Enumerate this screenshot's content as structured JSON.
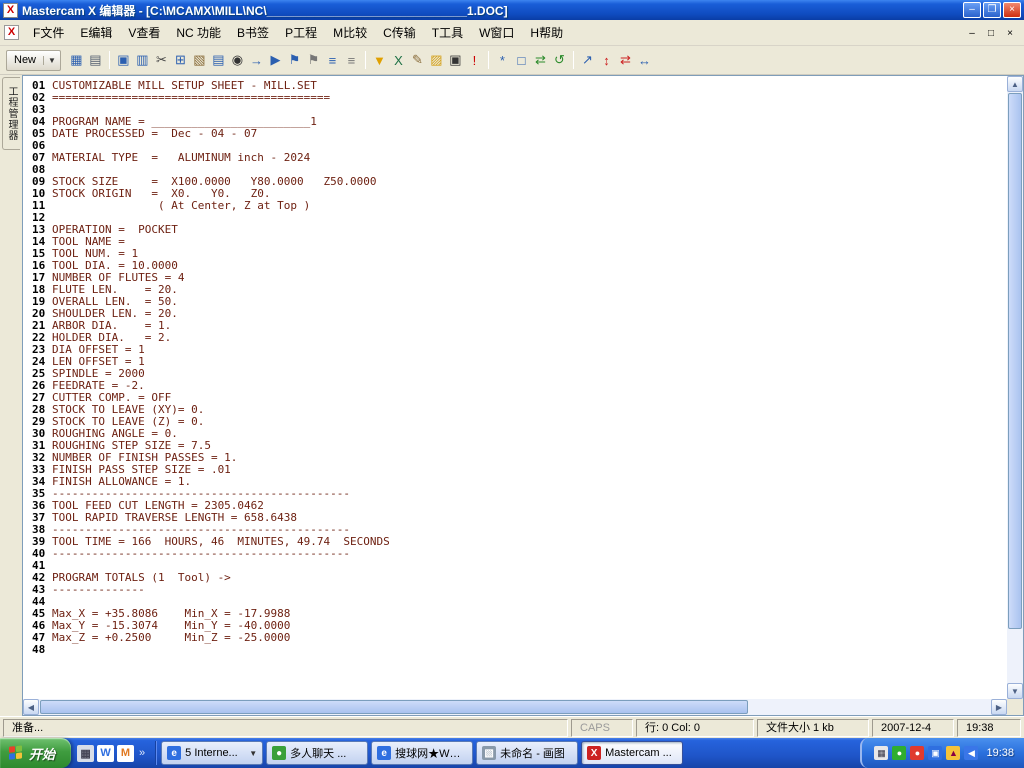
{
  "window": {
    "title": "Mastercam X 编辑器 - [C:\\MCAMX\\MILL\\NC\\______________________________1.DOC]",
    "minimize": "–",
    "maximize": "❐",
    "close": "×"
  },
  "menu": {
    "items": [
      "F文件",
      "E编辑",
      "V查看",
      "NC 功能",
      "B书签",
      "P工程",
      "M比较",
      "C传输",
      "T工具",
      "W窗口",
      "H帮助"
    ],
    "mdi": [
      "–",
      "□",
      "×"
    ]
  },
  "toolbar": {
    "new_label": "New",
    "icons": [
      {
        "name": "save-icon",
        "glyph": "▦",
        "color": "#2b5fb0"
      },
      {
        "name": "print-icon",
        "glyph": "▤",
        "color": "#556070"
      },
      {
        "sep": true
      },
      {
        "name": "open-icon",
        "glyph": "▣",
        "color": "#2b5fb0"
      },
      {
        "name": "view-icon",
        "glyph": "▥",
        "color": "#2b5fb0"
      },
      {
        "name": "cut-icon",
        "glyph": "✂",
        "color": "#444444"
      },
      {
        "name": "copy-icon",
        "glyph": "⊞",
        "color": "#2b5fb0"
      },
      {
        "name": "paste-icon",
        "glyph": "▧",
        "color": "#8a6d3b"
      },
      {
        "name": "print-preview-icon",
        "glyph": "▤",
        "color": "#2b5fb0"
      },
      {
        "name": "find-icon",
        "glyph": "◉",
        "color": "#333333"
      },
      {
        "name": "goto-icon",
        "glyph": "→",
        "color": "#2b5fb0"
      },
      {
        "name": "find-next-icon",
        "glyph": "▶",
        "color": "#2b5fb0"
      },
      {
        "name": "bookmark-icon",
        "glyph": "⚑",
        "color": "#2b5fb0"
      },
      {
        "name": "next-bookmark-icon",
        "glyph": "⚑",
        "color": "#777777"
      },
      {
        "name": "indent-icon",
        "glyph": "≡",
        "color": "#2b5fb0"
      },
      {
        "name": "outdent-icon",
        "glyph": "≡",
        "color": "#777777"
      },
      {
        "sep": true
      },
      {
        "name": "filter-icon",
        "glyph": "▼",
        "color": "#e0a000"
      },
      {
        "name": "excel-icon",
        "glyph": "X",
        "color": "#1e7145"
      },
      {
        "name": "edit-icon",
        "glyph": "✎",
        "color": "#8a6d3b"
      },
      {
        "name": "folder-icon",
        "glyph": "▨",
        "color": "#d4a017"
      },
      {
        "name": "command-prompt-icon",
        "glyph": "▣",
        "color": "#333333"
      },
      {
        "name": "warning-icon",
        "glyph": "!",
        "color": "#cc0000"
      },
      {
        "sep": true
      },
      {
        "name": "wand-icon",
        "glyph": "*",
        "color": "#2b5fb0"
      },
      {
        "name": "window-icon",
        "glyph": "□",
        "color": "#2b5fb0"
      },
      {
        "name": "refresh-icon",
        "glyph": "⇄",
        "color": "#2a8a2a"
      },
      {
        "name": "sync-icon",
        "glyph": "↺",
        "color": "#2a8a2a"
      },
      {
        "sep": true
      },
      {
        "name": "nc-backplot-icon",
        "glyph": "↗",
        "color": "#2b5fb0"
      },
      {
        "name": "nc-compare-icon",
        "glyph": "↕",
        "color": "#cc2222"
      },
      {
        "name": "nc-swap-icon",
        "glyph": "⇄",
        "color": "#cc2222"
      },
      {
        "name": "nc-transfer-icon",
        "glyph": "↔",
        "color": "#2b5fb0"
      }
    ]
  },
  "sidebar": {
    "tab_label": "工程管理器"
  },
  "editor": {
    "lines": [
      {
        "n": "01",
        "t": "CUSTOMIZABLE MILL SETUP SHEET - MILL.SET"
      },
      {
        "n": "02",
        "t": "=========================================="
      },
      {
        "n": "03",
        "t": ""
      },
      {
        "n": "04",
        "t": "PROGRAM NAME = ________________________1"
      },
      {
        "n": "05",
        "t": "DATE PROCESSED =  Dec - 04 - 07"
      },
      {
        "n": "06",
        "t": ""
      },
      {
        "n": "07",
        "t": "MATERIAL TYPE  =   ALUMINUM inch - 2024"
      },
      {
        "n": "08",
        "t": ""
      },
      {
        "n": "09",
        "t": "STOCK SIZE     =  X100.0000   Y80.0000   Z50.0000"
      },
      {
        "n": "10",
        "t": "STOCK ORIGIN   =  X0.   Y0.   Z0."
      },
      {
        "n": "11",
        "t": "                ( At Center, Z at Top )"
      },
      {
        "n": "12",
        "t": ""
      },
      {
        "n": "13",
        "t": "OPERATION =  POCKET"
      },
      {
        "n": "14",
        "t": "TOOL NAME = "
      },
      {
        "n": "15",
        "t": "TOOL NUM. = 1"
      },
      {
        "n": "16",
        "t": "TOOL DIA. = 10.0000"
      },
      {
        "n": "17",
        "t": "NUMBER OF FLUTES = 4"
      },
      {
        "n": "18",
        "t": "FLUTE LEN.    = 20."
      },
      {
        "n": "19",
        "t": "OVERALL LEN.  = 50."
      },
      {
        "n": "20",
        "t": "SHOULDER LEN. = 20."
      },
      {
        "n": "21",
        "t": "ARBOR DIA.    = 1."
      },
      {
        "n": "22",
        "t": "HOLDER DIA.   = 2."
      },
      {
        "n": "23",
        "t": "DIA OFFSET = 1"
      },
      {
        "n": "24",
        "t": "LEN OFFSET = 1"
      },
      {
        "n": "25",
        "t": "SPINDLE = 2000"
      },
      {
        "n": "26",
        "t": "FEEDRATE = -2."
      },
      {
        "n": "27",
        "t": "CUTTER COMP. = OFF"
      },
      {
        "n": "28",
        "t": "STOCK TO LEAVE (XY)= 0."
      },
      {
        "n": "29",
        "t": "STOCK TO LEAVE (Z) = 0."
      },
      {
        "n": "30",
        "t": "ROUGHING ANGLE = 0."
      },
      {
        "n": "31",
        "t": "ROUGHING STEP SIZE = 7.5"
      },
      {
        "n": "32",
        "t": "NUMBER OF FINISH PASSES = 1."
      },
      {
        "n": "33",
        "t": "FINISH PASS STEP SIZE = .01"
      },
      {
        "n": "34",
        "t": "FINISH ALLOWANCE = 1."
      },
      {
        "n": "35",
        "t": "---------------------------------------------"
      },
      {
        "n": "36",
        "t": "TOOL FEED CUT LENGTH = 2305.0462"
      },
      {
        "n": "37",
        "t": "TOOL RAPID TRAVERSE LENGTH = 658.6438"
      },
      {
        "n": "38",
        "t": "---------------------------------------------"
      },
      {
        "n": "39",
        "t": "TOOL TIME = 166  HOURS, 46  MINUTES, 49.74  SECONDS"
      },
      {
        "n": "40",
        "t": "---------------------------------------------"
      },
      {
        "n": "41",
        "t": ""
      },
      {
        "n": "42",
        "t": "PROGRAM TOTALS (1  Tool) ->"
      },
      {
        "n": "43",
        "t": "--------------"
      },
      {
        "n": "44",
        "t": ""
      },
      {
        "n": "45",
        "t": "Max_X = +35.8086    Min_X = -17.9988"
      },
      {
        "n": "46",
        "t": "Max_Y = -15.3074    Min_Y = -40.0000"
      },
      {
        "n": "47",
        "t": "Max_Z = +0.2500     Min_Z = -25.0000"
      },
      {
        "n": "48",
        "t": ""
      }
    ]
  },
  "statusbar": {
    "ready": "准备...",
    "caps": "CAPS",
    "line_col": "行:  0   Col:  0",
    "file_size": "文件大小 1 kb",
    "date": "2007-12-4",
    "time": "19:38"
  },
  "taskbar": {
    "start_label": "开始",
    "flag_colors": [
      "#e8402a",
      "#7fbf3f",
      "#2f6fe0",
      "#f5c33a"
    ],
    "quicklaunch": [
      {
        "name": "quicklaunch-desktop-icon",
        "glyph": "▦",
        "bg": "#d8dde8",
        "color": "#445"
      },
      {
        "name": "quicklaunch-word-icon",
        "glyph": "W",
        "bg": "#ffffff",
        "color": "#2f6fe0"
      },
      {
        "name": "quicklaunch-media-icon",
        "glyph": "M",
        "bg": "#ffffff",
        "color": "#e07820"
      }
    ],
    "chevron": "»",
    "buttons": [
      {
        "label": "5 Interne...",
        "icon_glyph": "e",
        "icon_bg": "#2f6fe0",
        "dropdown": true,
        "active": false
      },
      {
        "label": "多人聊天 ...",
        "icon_glyph": "●",
        "icon_bg": "#3aa03a",
        "dropdown": false,
        "active": false
      },
      {
        "label": "搜球网★WW...",
        "icon_glyph": "e",
        "icon_bg": "#2f6fe0",
        "dropdown": false,
        "active": false
      },
      {
        "label": "未命名 - 画图",
        "icon_glyph": "▧",
        "icon_bg": "#8899aa",
        "dropdown": false,
        "active": false
      },
      {
        "label": "Mastercam ...",
        "icon_glyph": "X",
        "icon_bg": "#cc2222",
        "dropdown": false,
        "active": true
      }
    ],
    "tray": {
      "icons": [
        {
          "name": "tray-ime-icon",
          "glyph": "▦",
          "bg": "#e8e8e8",
          "color": "#334"
        },
        {
          "name": "tray-antivirus-icon",
          "glyph": "●",
          "bg": "#2fae2f",
          "color": "#fff"
        },
        {
          "name": "tray-update-icon",
          "glyph": "●",
          "bg": "#e03a2e",
          "color": "#fff"
        },
        {
          "name": "tray-network-icon",
          "glyph": "▣",
          "bg": "#2f6fe0",
          "color": "#fff"
        },
        {
          "name": "tray-security-icon",
          "glyph": "▲",
          "bg": "#f5c33a",
          "color": "#804"
        },
        {
          "name": "tray-volume-icon",
          "glyph": "◀",
          "bg": "#3a76e8",
          "color": "#fff"
        }
      ],
      "time": "19:38"
    }
  }
}
